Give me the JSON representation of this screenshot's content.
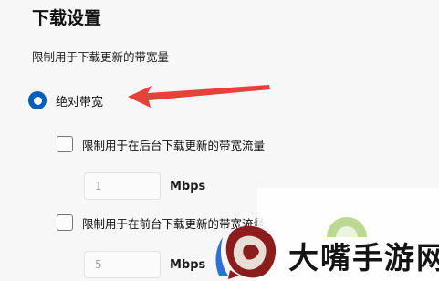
{
  "page": {
    "title": "下载设置",
    "subtitle": "限制用于下载更新的带宽量"
  },
  "options": {
    "absolute_bandwidth_label": "绝对带宽",
    "background_limit_label": "限制用于在后台下载更新的带宽流量",
    "background_value": "1",
    "foreground_limit_label": "限制用于在前台下载更新的带宽流量",
    "foreground_value": "5",
    "unit": "Mbps"
  },
  "watermark": {
    "brand": "大嘴手游网"
  },
  "colors": {
    "accent": "#005fb8",
    "arrow": "#e8403a",
    "background": "#f7f7f8"
  },
  "icons": {
    "arrow": "red-arrow-icon",
    "logo": "dazui-logo-icon"
  }
}
